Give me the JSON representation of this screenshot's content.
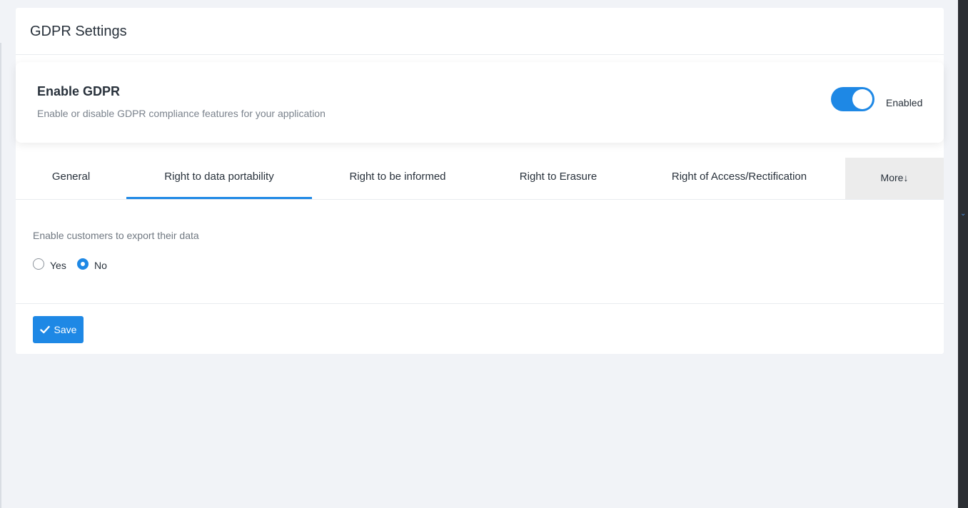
{
  "page": {
    "title": "GDPR Settings"
  },
  "gdpr": {
    "title": "Enable GDPR",
    "description": "Enable or disable GDPR compliance features for your application",
    "toggle_state": "on",
    "toggle_label": "Enabled"
  },
  "tabs": [
    {
      "label": "General",
      "active": false
    },
    {
      "label": "Right to data portability",
      "active": true
    },
    {
      "label": "Right to be informed",
      "active": false
    },
    {
      "label": "Right to Erasure",
      "active": false
    },
    {
      "label": "Right of Access/Rectification",
      "active": false
    },
    {
      "label": "More↓",
      "active": false
    }
  ],
  "portability": {
    "question": "Enable customers to export their data",
    "options": [
      {
        "label": "Yes",
        "checked": false
      },
      {
        "label": "No",
        "checked": true
      }
    ]
  },
  "footer": {
    "save_label": "Save",
    "save_icon": "check-icon"
  },
  "colors": {
    "accent": "#1e88e5",
    "background": "#f1f3f7",
    "card": "#ffffff",
    "more_tab": "#ececec"
  }
}
